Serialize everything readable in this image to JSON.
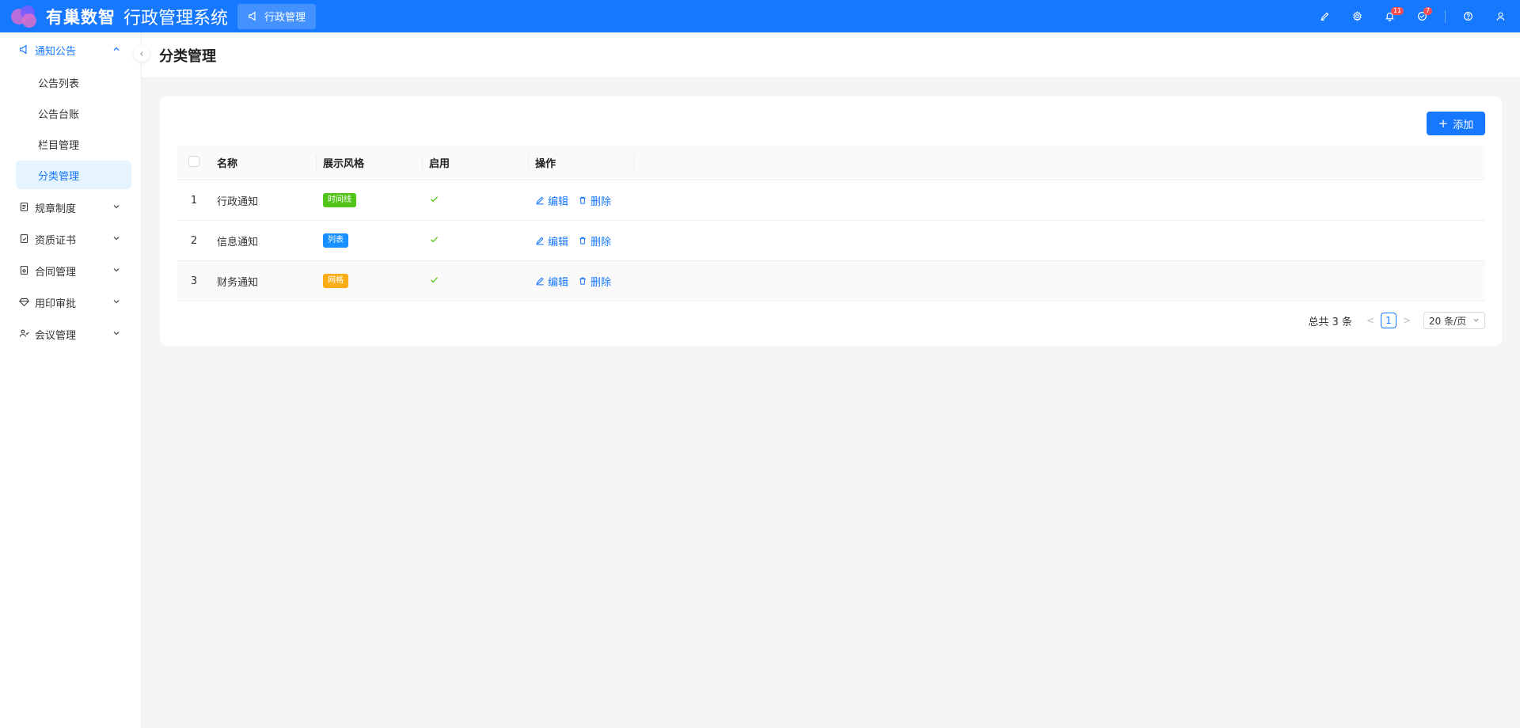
{
  "header": {
    "brand": "有巢数智",
    "system_title": "行政管理系统",
    "nav_tab": "行政管理",
    "notifications_badge": "11",
    "tasks_badge": "7"
  },
  "sidebar": {
    "groups": [
      {
        "label": "通知公告",
        "expanded": true,
        "items": [
          "公告列表",
          "公告台账",
          "栏目管理",
          "分类管理"
        ],
        "active_item": "分类管理"
      },
      {
        "label": "规章制度",
        "expanded": false
      },
      {
        "label": "资质证书",
        "expanded": false
      },
      {
        "label": "合同管理",
        "expanded": false
      },
      {
        "label": "用印审批",
        "expanded": false
      },
      {
        "label": "会议管理",
        "expanded": false
      }
    ]
  },
  "page": {
    "title": "分类管理"
  },
  "toolbar": {
    "add_label": "添加"
  },
  "table": {
    "columns": [
      "名称",
      "展示风格",
      "启用",
      "操作"
    ],
    "rows": [
      {
        "index": "1",
        "name": "行政通知",
        "style": "时间线",
        "style_color": "#52c41a",
        "enabled": true,
        "edit": "编辑",
        "delete": "删除"
      },
      {
        "index": "2",
        "name": "信息通知",
        "style": "列表",
        "style_color": "#1890ff",
        "enabled": true,
        "edit": "编辑",
        "delete": "删除"
      },
      {
        "index": "3",
        "name": "财务通知",
        "style": "网格",
        "style_color": "#faad14",
        "enabled": true,
        "edit": "编辑",
        "delete": "删除"
      }
    ]
  },
  "pagination": {
    "total_text": "总共 3 条",
    "current_page": "1",
    "page_size": "20 条/页"
  },
  "colors": {
    "primary": "#1677ff",
    "header_bg": "#1677ff",
    "active_bg": "#e6f4ff"
  }
}
